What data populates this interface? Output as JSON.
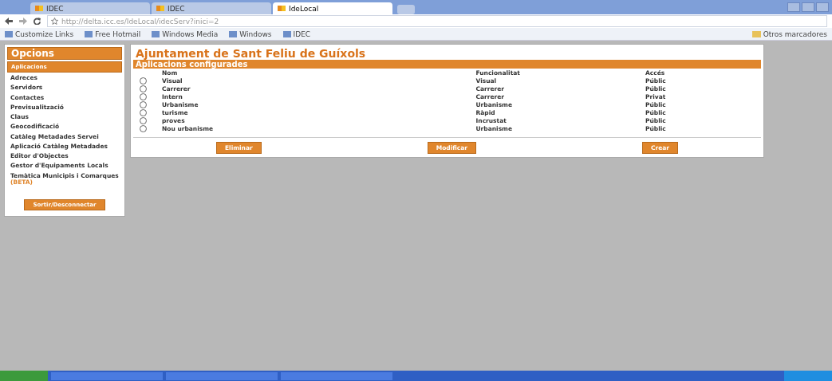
{
  "browser": {
    "tabs": [
      {
        "label": "IDEC",
        "selected": false
      },
      {
        "label": "IDEC",
        "selected": false
      },
      {
        "label": "IdeLocal",
        "selected": true
      }
    ],
    "address": "http://delta.icc.es/IdeLocal/idecServ?inici=2",
    "bookmarks": [
      "Customize Links",
      "Free Hotmail",
      "Windows Media",
      "Windows",
      "IDEC"
    ],
    "other_bookmarks": "Otros marcadores"
  },
  "sidebar": {
    "title": "Opcions",
    "active_item": "Aplicacions",
    "items": [
      {
        "label": "Adreces"
      },
      {
        "label": "Servidors"
      },
      {
        "label": "Contactes"
      },
      {
        "label": "Previsualització"
      },
      {
        "label": "Claus"
      },
      {
        "label": "Geocodificació"
      },
      {
        "label": "Catàleg Metadades Servei"
      },
      {
        "label": "Aplicació Catàleg Metadades"
      },
      {
        "label": "Editor d'Objectes"
      },
      {
        "label": "Gestor d'Equipaments Locals"
      },
      {
        "label": "Temàtica Municipis i Comarques",
        "badge": "(BETA)"
      }
    ],
    "logout": "Sortir/Desconnectar"
  },
  "main": {
    "title": "Ajuntament de Sant Feliu de Guíxols",
    "section": "Aplicacions configurades",
    "columns": [
      "Nom",
      "Funcionalitat",
      "Accés"
    ],
    "rows": [
      {
        "name": "Visual",
        "function": "Visual",
        "access": "Públic",
        "selected": false
      },
      {
        "name": "Carrerer",
        "function": "Carrerer",
        "access": "Públic",
        "selected": false
      },
      {
        "name": "Intern",
        "function": "Carrerer",
        "access": "Privat",
        "selected": false
      },
      {
        "name": "Urbanisme",
        "function": "Urbanisme",
        "access": "Públic",
        "selected": false
      },
      {
        "name": "turisme",
        "function": "Ràpid",
        "access": "Públic",
        "selected": false
      },
      {
        "name": "proves",
        "function": "Incrustat",
        "access": "Públic",
        "selected": false
      },
      {
        "name": "Nou urbanisme",
        "function": "Urbanisme",
        "access": "Públic",
        "selected": false
      }
    ],
    "buttons": [
      "Eliminar",
      "Modificar",
      "Crear"
    ]
  }
}
